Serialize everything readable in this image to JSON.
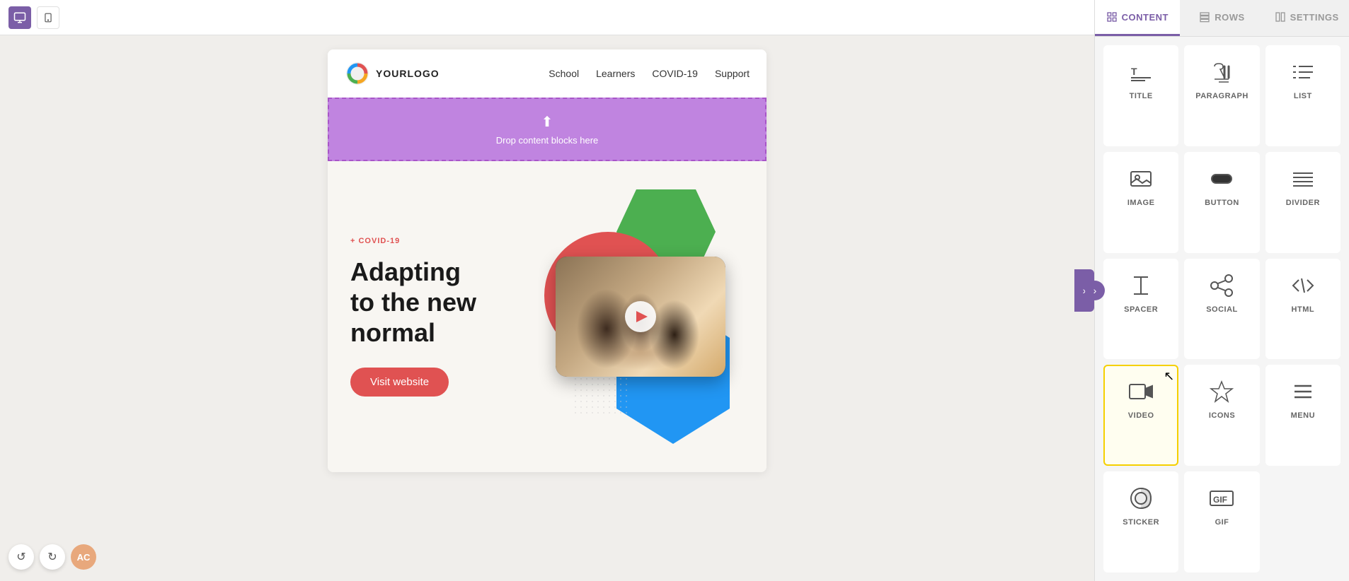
{
  "toolbar": {
    "desktop_icon": "🖥",
    "mobile_icon": "📱",
    "undo_icon": "↺",
    "redo_icon": "↻",
    "avatar_label": "AC"
  },
  "tabs": {
    "content_label": "CONTENT",
    "rows_label": "ROWS",
    "settings_label": "SETTINGS"
  },
  "email": {
    "logo_text": "YOURLOGO",
    "nav_links": [
      "School",
      "Learners",
      "COVID-19",
      "Support"
    ],
    "drop_zone_text": "Drop content blocks here",
    "hero_tag": "+ COVID-19",
    "hero_title": "Adapting\nto the new\nnormal",
    "hero_button": "Visit website"
  },
  "content_items": [
    {
      "id": "title",
      "label": "TITLE",
      "icon_type": "title"
    },
    {
      "id": "paragraph",
      "label": "PARAGRAPH",
      "icon_type": "paragraph"
    },
    {
      "id": "list",
      "label": "LIST",
      "icon_type": "list"
    },
    {
      "id": "image",
      "label": "IMAGE",
      "icon_type": "image"
    },
    {
      "id": "button",
      "label": "BUTTON",
      "icon_type": "button"
    },
    {
      "id": "divider",
      "label": "DIVIDER",
      "icon_type": "divider"
    },
    {
      "id": "spacer",
      "label": "SPACER",
      "icon_type": "spacer"
    },
    {
      "id": "social",
      "label": "SOCIAL",
      "icon_type": "social"
    },
    {
      "id": "html",
      "label": "HTML",
      "icon_type": "html"
    },
    {
      "id": "video",
      "label": "VIDEO",
      "icon_type": "video",
      "highlighted": true
    },
    {
      "id": "icons",
      "label": "ICONS",
      "icon_type": "icons"
    },
    {
      "id": "menu",
      "label": "MENU",
      "icon_type": "menu"
    },
    {
      "id": "sticker",
      "label": "STICKER",
      "icon_type": "sticker"
    },
    {
      "id": "gif",
      "label": "GIF",
      "icon_type": "gif"
    }
  ],
  "colors": {
    "accent": "#7b5ea7",
    "drop_zone_bg": "#c084e0",
    "hero_tag_color": "#e05252",
    "hero_btn_color": "#e05252",
    "highlight_border": "#f5d000"
  }
}
